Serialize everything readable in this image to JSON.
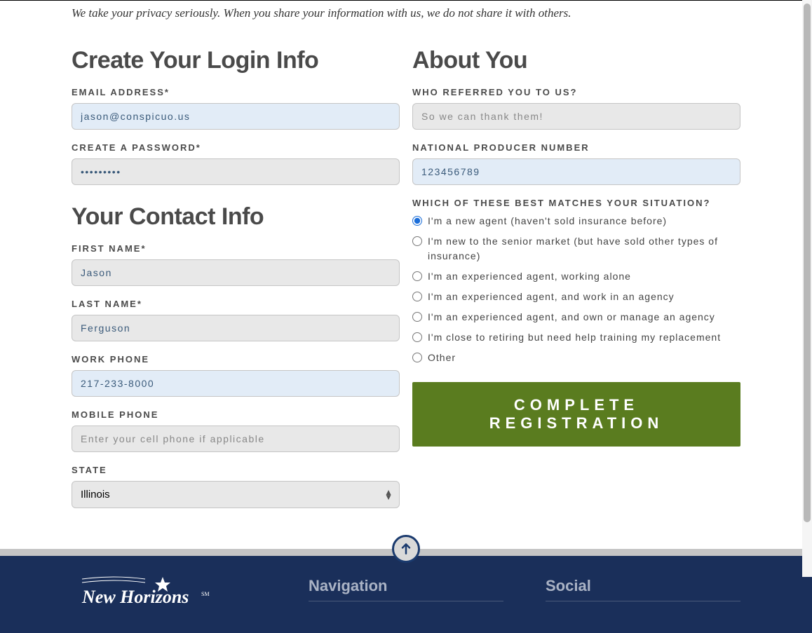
{
  "privacy_note": "We take your privacy seriously. When you share your information with us, we do not share it with others.",
  "left": {
    "section1_heading": "Create Your Login Info",
    "email_label": "EMAIL ADDRESS*",
    "email_value": "jason@conspicuo.us",
    "password_label": "CREATE A PASSWORD*",
    "password_value": "•••••••••",
    "section2_heading": "Your Contact Info",
    "firstname_label": "FIRST NAME*",
    "firstname_value": "Jason",
    "lastname_label": "LAST NAME*",
    "lastname_value": "Ferguson",
    "workphone_label": "WORK PHONE",
    "workphone_value": "217-233-8000",
    "mobilephone_label": "MOBILE PHONE",
    "mobilephone_placeholder": "Enter your cell phone if applicable",
    "state_label": "STATE",
    "state_value": "Illinois"
  },
  "right": {
    "section_heading": "About You",
    "referred_label": "WHO REFERRED YOU TO US?",
    "referred_placeholder": "So we can thank them!",
    "npn_label": "NATIONAL PRODUCER NUMBER",
    "npn_value": "123456789",
    "situation_label": "WHICH OF THESE BEST MATCHES YOUR SITUATION?",
    "options": [
      "I'm a new agent (haven't sold insurance before)",
      "I'm new to the senior market (but have sold other types of insurance)",
      "I'm an experienced agent, working alone",
      "I'm an experienced agent, and work in an agency",
      "I'm an experienced agent, and own or manage an agency",
      "I'm close to retiring but need help training my replacement",
      "Other"
    ],
    "selected_option": 0,
    "submit_label": "COMPLETE REGISTRATION"
  },
  "footer": {
    "logo_text": "New Horizons",
    "nav_heading": "Navigation",
    "social_heading": "Social"
  }
}
